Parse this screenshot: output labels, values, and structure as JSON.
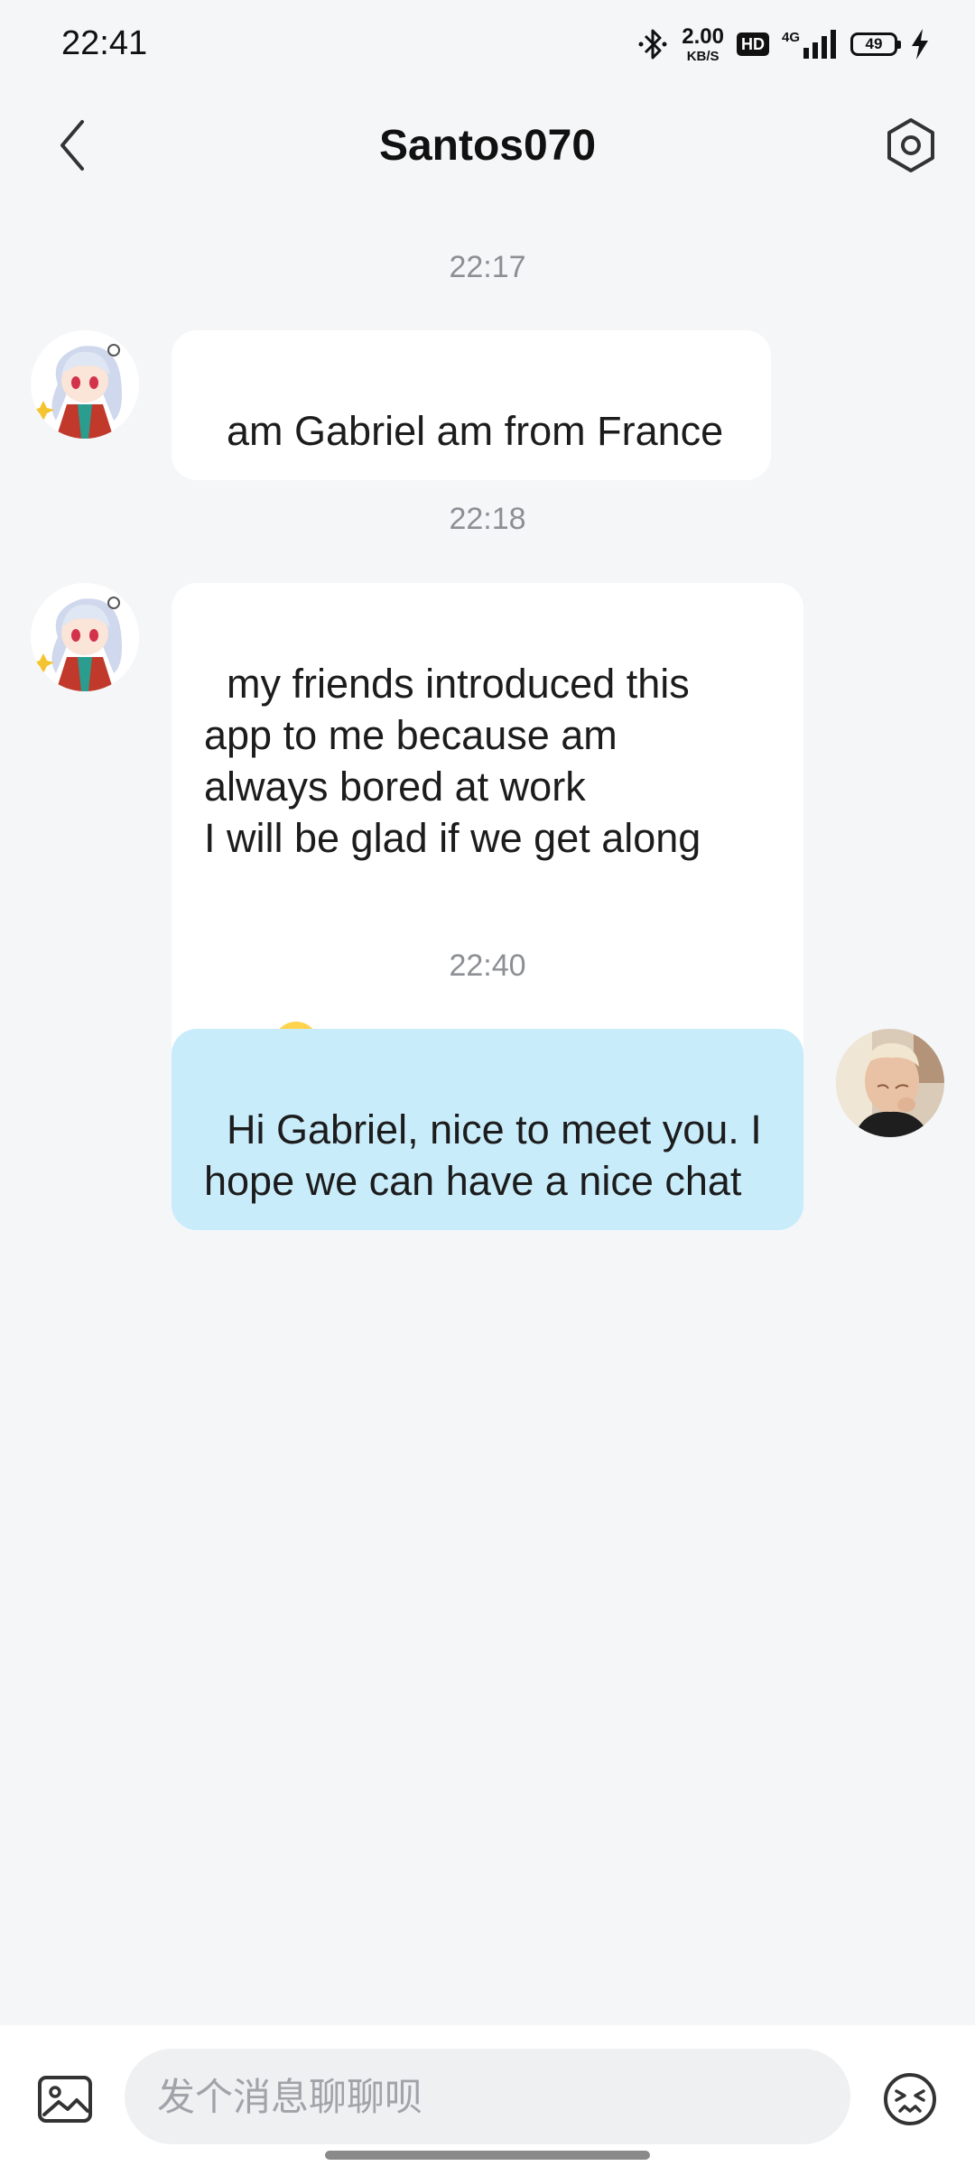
{
  "status_bar": {
    "time": "22:41",
    "net_speed_value": "2.00",
    "net_speed_unit": "KB/S",
    "hd_label": "HD",
    "network_label": "4G",
    "battery_level": "49",
    "icons": [
      "bluetooth-icon",
      "signal-icon",
      "battery-icon",
      "charging-icon"
    ]
  },
  "header": {
    "title": "Santos070",
    "back_icon": "chevron-left-icon",
    "settings_icon": "hexagon-settings-icon"
  },
  "messages": [
    {
      "timestamp": "22:17",
      "direction": "incoming",
      "avatar": "anime-girl-avatar",
      "text": "am Gabriel am from France"
    },
    {
      "timestamp": "22:18",
      "direction": "incoming",
      "avatar": "anime-girl-avatar",
      "text": "my friends introduced this\napp to me because am\nalways bored at work\nI will be glad if we get along",
      "emoji": "smiling-face-emoji"
    },
    {
      "timestamp": "22:40",
      "direction": "outgoing",
      "avatar": "user-photo-avatar",
      "text": "Hi Gabriel, nice to meet you. I\nhope we can have a nice chat"
    }
  ],
  "input_bar": {
    "placeholder": "发个消息聊聊呗",
    "image_icon": "image-icon",
    "emoji_icon": "emoji-face-icon"
  },
  "colors": {
    "background": "#f5f6f8",
    "incoming_bubble": "#ffffff",
    "outgoing_bubble": "#c9ecfb",
    "timestamp_text": "#8c8f94"
  }
}
